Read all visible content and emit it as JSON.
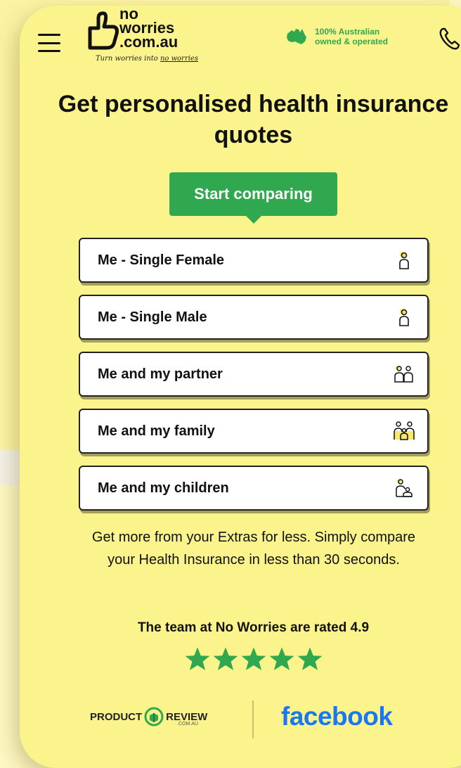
{
  "header": {
    "logo_line1": "no",
    "logo_line2": "worries",
    "logo_line3": ".com.au",
    "tagline_pre": "Turn worries into ",
    "tagline_post": "no worries",
    "badge_line1": "100% Australian",
    "badge_line2": "owned & operated",
    "menu_icon": "hamburger-menu-icon",
    "phone_icon": "phone-icon"
  },
  "main": {
    "title": "Get personalised health insurance quotes",
    "cta_label": "Start comparing",
    "options": [
      {
        "label": "Me - Single Female",
        "icon": "single-person-icon"
      },
      {
        "label": "Me - Single Male",
        "icon": "single-person-icon"
      },
      {
        "label": "Me and my partner",
        "icon": "couple-icon"
      },
      {
        "label": "Me and my family",
        "icon": "family-icon"
      },
      {
        "label": "Me and my children",
        "icon": "parent-child-icon"
      }
    ],
    "blurb": "Get more from your Extras for less. Simply compare your Health Insurance in less than 30 seconds."
  },
  "reviews": {
    "rating_text": "The team at No Worries are rated 4.9",
    "stars": 5,
    "productreview_left": "PRODUCT",
    "productreview_right": "REVIEW",
    "productreview_sub": ".COM.AU",
    "facebook": "facebook"
  },
  "colors": {
    "background": "#fbf48c",
    "accent_green": "#2fa84f",
    "facebook_blue": "#1877f2"
  }
}
